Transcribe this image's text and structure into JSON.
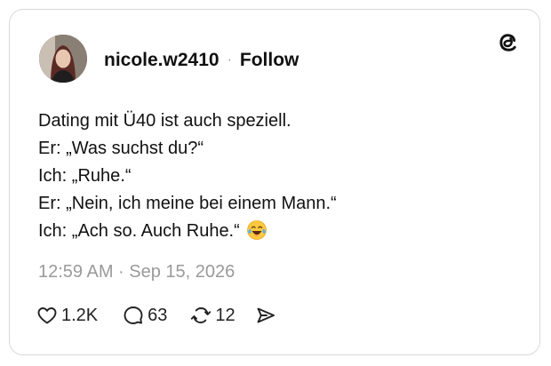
{
  "post": {
    "username": "nicole.w2410",
    "separator": "·",
    "follow_label": "Follow",
    "lines": [
      "Dating mit Ü40 ist auch speziell.",
      "Er: „Was suchst du?“",
      "Ich: „Ruhe.“",
      "Er: „Nein, ich meine bei einem Mann.“",
      "Ich: „Ach so. Auch Ruhe.“"
    ],
    "emoji": "face-with-tears-of-joy",
    "timestamp": "12:59 AM · Sep 15, 2026"
  },
  "actions": {
    "likes": "1.2K",
    "replies": "63",
    "reposts": "12"
  },
  "icons": {
    "logo": "threads-logo-icon",
    "like": "heart-icon",
    "reply": "comment-bubble-icon",
    "repost": "repost-arrows-icon",
    "share": "send-icon"
  },
  "colors": {
    "text": "#111111",
    "muted": "#9a9a9a",
    "border": "#d9d9d9",
    "background": "#ffffff"
  }
}
